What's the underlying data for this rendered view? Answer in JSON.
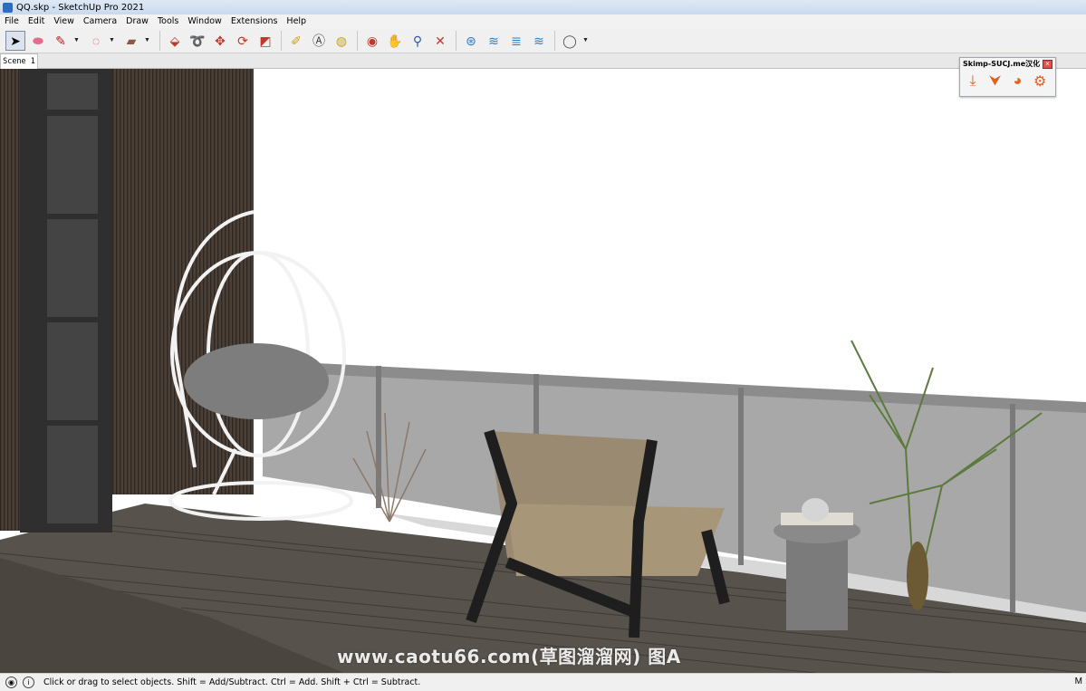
{
  "window": {
    "title": "QQ.skp - SketchUp Pro 2021"
  },
  "menu": [
    "File",
    "Edit",
    "View",
    "Camera",
    "Draw",
    "Tools",
    "Window",
    "Extensions",
    "Help"
  ],
  "toolbar": {
    "tools": [
      {
        "name": "select-tool",
        "glyph": "➤",
        "color": "#000000"
      },
      {
        "name": "eraser-tool",
        "glyph": "⬬",
        "color": "#e66a8e"
      },
      {
        "name": "line-tool",
        "glyph": "✎",
        "color": "#b42323"
      },
      {
        "name": "arc-tool",
        "glyph": "◌",
        "color": "#c0392b"
      },
      {
        "name": "rectangle-tool",
        "glyph": "▰",
        "color": "#8a5a44"
      },
      {
        "name": "push-pull-tool",
        "glyph": "⬙",
        "color": "#c0392b"
      },
      {
        "name": "follow-me-tool",
        "glyph": "➰",
        "color": "#c0392b"
      },
      {
        "name": "move-tool",
        "glyph": "✥",
        "color": "#c0392b"
      },
      {
        "name": "rotate-tool",
        "glyph": "⟳",
        "color": "#c0392b"
      },
      {
        "name": "scale-tool",
        "glyph": "◩",
        "color": "#c0392b"
      },
      {
        "name": "tape-measure-tool",
        "glyph": "✐",
        "color": "#c9a21a"
      },
      {
        "name": "text-tool",
        "glyph": "Ⓐ",
        "color": "#444444"
      },
      {
        "name": "paint-bucket-tool",
        "glyph": "◍",
        "color": "#c9a21a"
      },
      {
        "name": "orbit-tool",
        "glyph": "◉",
        "color": "#c0392b"
      },
      {
        "name": "pan-tool",
        "glyph": "✋",
        "color": "#c9a21a"
      },
      {
        "name": "zoom-tool",
        "glyph": "⚲",
        "color": "#2c5aa0"
      },
      {
        "name": "zoom-extents-tool",
        "glyph": "✕",
        "color": "#c0392b"
      },
      {
        "name": "warehouse-tool",
        "glyph": "⊛",
        "color": "#2c7bbf"
      },
      {
        "name": "extension-warehouse-tool",
        "glyph": "≋",
        "color": "#2c7bbf"
      },
      {
        "name": "layout-tool",
        "glyph": "≣",
        "color": "#2c7bbf"
      },
      {
        "name": "extension-manager-tool",
        "glyph": "≋",
        "color": "#2c7bbf"
      },
      {
        "name": "account-tool",
        "glyph": "◯",
        "color": "#555555"
      }
    ]
  },
  "scene": {
    "tab_label": "Scene 1"
  },
  "skimp_panel": {
    "title": "Skimp-SUCJ.me汉化",
    "close": "×"
  },
  "watermark": "www.caotu66.com(草图溜溜网) 图A",
  "status": {
    "message": "Click or drag to select objects. Shift = Add/Subtract. Ctrl = Add. Shift + Ctrl = Subtract.",
    "right": "M"
  },
  "colors": {
    "accent": "#2b6cc4",
    "deck": "#5b5650",
    "glass": "#a7a7a7",
    "wall": "#4a3f37"
  }
}
